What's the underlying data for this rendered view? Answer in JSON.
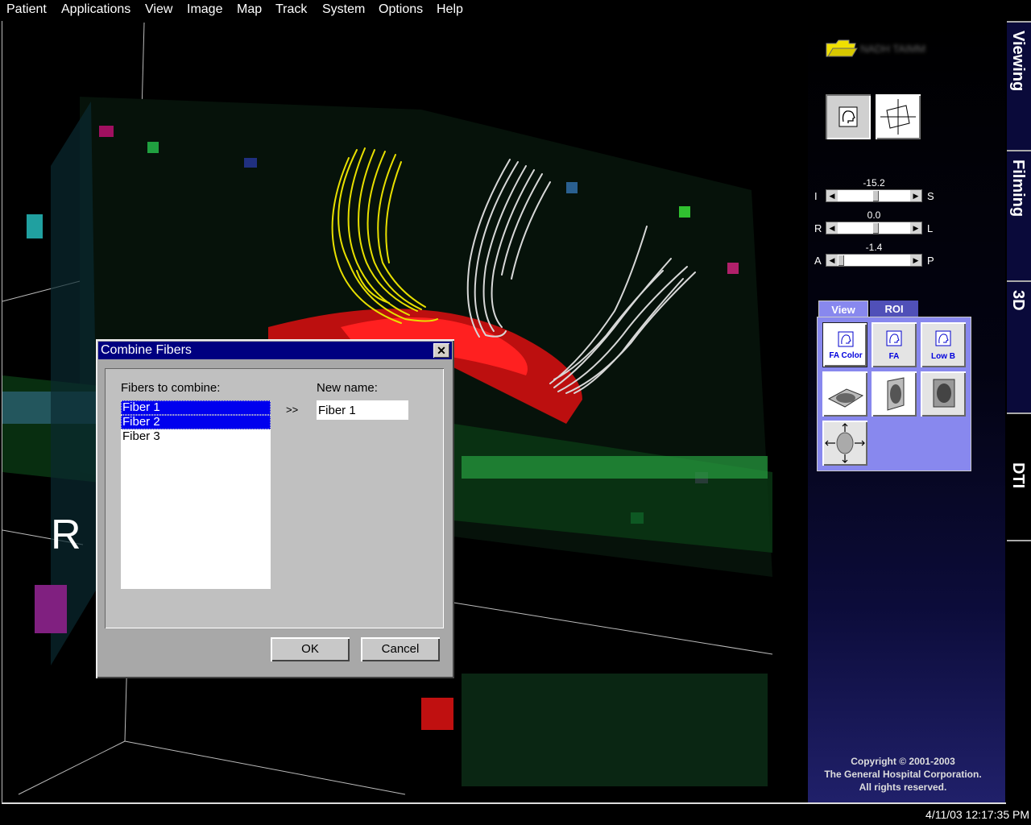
{
  "menu": [
    "Patient",
    "Applications",
    "View",
    "Image",
    "Map",
    "Track",
    "System",
    "Options",
    "Help"
  ],
  "viewport": {
    "orientation_label": "R"
  },
  "panel": {
    "folder_icon": "folder-icon",
    "patient_name_blurred": "NADH TAIMM",
    "view_buttons": [
      "head-view-icon",
      "crosshair-planes-icon"
    ],
    "sliders": [
      {
        "value": "-15.2",
        "left": "I",
        "right": "S",
        "position": 0.47
      },
      {
        "value": "0.0",
        "left": "R",
        "right": "L",
        "position": 0.5
      },
      {
        "value": "-1.4",
        "left": "A",
        "right": "P",
        "position": 0.05
      }
    ],
    "tabs": {
      "view": "View",
      "roi": "ROI"
    },
    "map_buttons": [
      {
        "label": "FA Color",
        "icon": "head-fa-color-icon",
        "selected": true
      },
      {
        "label": "FA",
        "icon": "head-fa-icon",
        "selected": false
      },
      {
        "label": "Low B",
        "icon": "head-low-b-icon",
        "selected": false
      }
    ],
    "slice_buttons": [
      "axial-slice-icon",
      "sagittal-slice-icon",
      "coronal-slice-icon"
    ],
    "nav_button": "head-rotate-icon",
    "copyright": [
      "Copyright © 2001-2003",
      "The General Hospital Corporation.",
      "All rights reserved."
    ]
  },
  "side_tabs": [
    {
      "label": "Viewing",
      "active": false
    },
    {
      "label": "Filming",
      "active": false
    },
    {
      "label": "3D",
      "active": false
    },
    {
      "label": "DTI",
      "active": true
    }
  ],
  "status": {
    "datetime": "4/11/03 12:17:35 PM"
  },
  "dialog": {
    "title": "Combine Fibers",
    "fibers_label": "Fibers to combine:",
    "new_name_label": "New name:",
    "fibers": [
      {
        "name": "Fiber 1",
        "selected": true
      },
      {
        "name": "Fiber 2",
        "selected": true
      },
      {
        "name": "Fiber 3",
        "selected": false
      }
    ],
    "transfer_label": ">>",
    "new_name_value": "Fiber 1",
    "ok_label": "OK",
    "cancel_label": "Cancel",
    "close_label": "✕"
  },
  "colors": {
    "dialog_title_bar": "#000080",
    "selection": "#0000ee",
    "panel_tab": "#8888ee",
    "fiber_yellow": "#e8e000",
    "fiber_white": "#d8d8d8",
    "fa_red": "#ff0000"
  }
}
